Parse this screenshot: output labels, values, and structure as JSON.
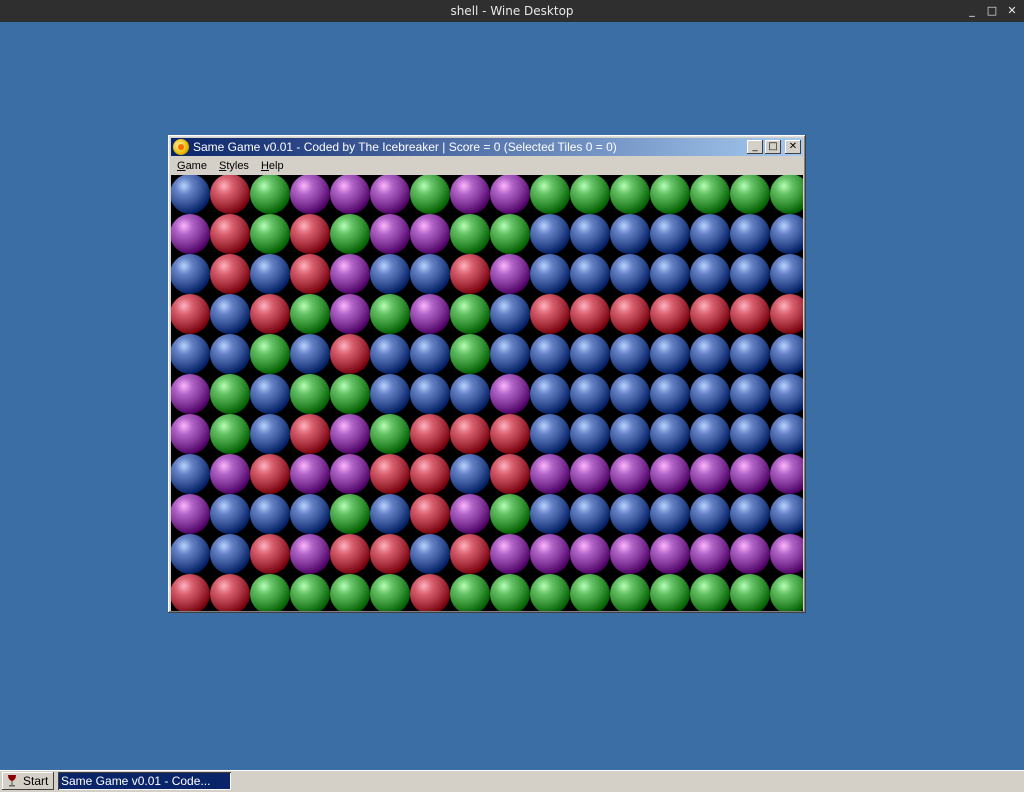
{
  "host": {
    "title": "shell - Wine Desktop",
    "controls": [
      "_",
      "□",
      "✕"
    ]
  },
  "window": {
    "title": "Same Game v0.01 - Coded by The Icebreaker | Score = 0 (Selected Tiles 0 = 0)",
    "buttons": {
      "minimize": "_",
      "maximize": "□",
      "close": "✕"
    }
  },
  "menu": {
    "items": [
      {
        "key": "G",
        "rest": "ame"
      },
      {
        "key": "S",
        "rest": "tyles"
      },
      {
        "key": "H",
        "rest": "elp"
      }
    ]
  },
  "board": {
    "cols": 16,
    "rows": 11,
    "colors": {
      "B": "#3e5a9e",
      "R": "#b23a48",
      "G": "#3d9a3d",
      "P": "#8a3da0"
    },
    "grid": [
      "BRGPPPGPPGGGGGGG",
      "PRGRGPPGGBBBBBBB",
      "BRBRPBBRPBBBBBBB",
      "RBRGPGPGBRRRRRRR",
      "BBGBRBBGBBBBBBBB",
      "PGBGGBBBPBBBBBBB",
      "PGBRPGRRRBBBBBBB",
      "BPRPPRRBRPPPPPPP",
      "PBBBGBRPGBBBBBBB",
      "BBRPRRBRPPPPPPPP",
      "RRGGGGRGGGGGGGGG"
    ]
  },
  "taskbar": {
    "start_label": "Start",
    "task_label": "Same Game v0.01 - Code..."
  }
}
